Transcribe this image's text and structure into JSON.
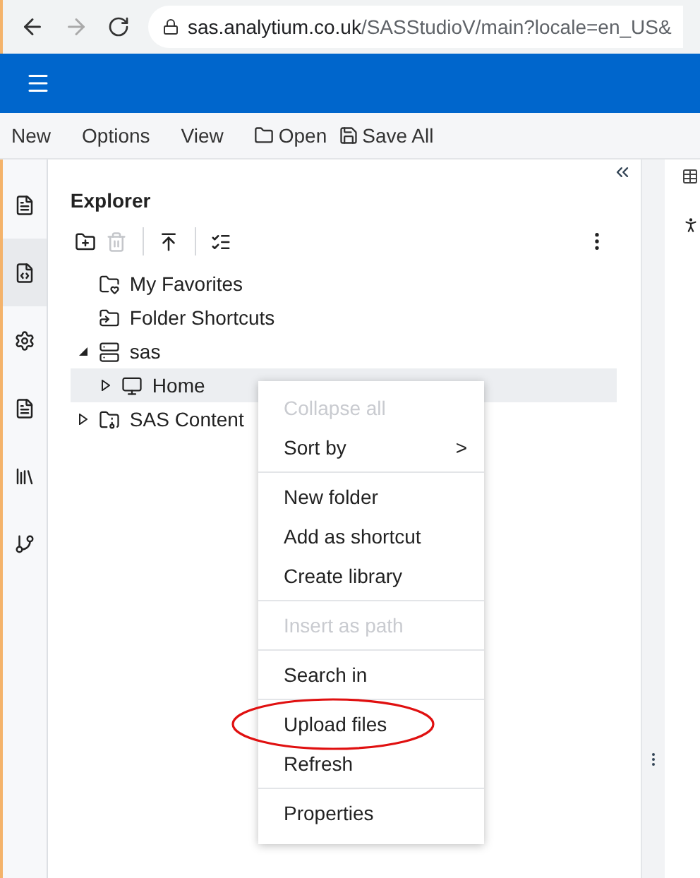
{
  "browser": {
    "url_domain": "sas.analytium.co.uk",
    "url_path": "/SASStudioV/main?locale=en_US&"
  },
  "menu_bar": [
    "New",
    "Options",
    "View",
    "Open",
    "Save All"
  ],
  "rail": [
    {
      "selected": false
    },
    {
      "selected": true
    },
    {
      "selected": false
    },
    {
      "selected": false
    },
    {
      "selected": false
    },
    {
      "selected": false
    }
  ],
  "explorer": {
    "title": "Explorer",
    "toolbar": [
      {
        "disabled": false
      },
      {
        "disabled": true
      },
      {
        "disabled": false
      },
      {
        "disabled": false
      }
    ],
    "tree": [
      {
        "label": "My Favorites",
        "selected": false
      },
      {
        "label": "Folder Shortcuts",
        "selected": false
      },
      {
        "label": "sas",
        "expanded": true,
        "selected": false,
        "children": [
          {
            "label": "Home",
            "expanded": false,
            "selected": true
          }
        ]
      },
      {
        "label": "SAS Content",
        "expanded": false,
        "selected": false
      }
    ]
  },
  "context_menu": [
    [
      {
        "label": "Collapse all",
        "disabled": true
      },
      {
        "label": "Sort by",
        "disabled": false,
        "arrow": ">"
      }
    ],
    [
      {
        "label": "New folder",
        "disabled": false
      },
      {
        "label": "Add as shortcut",
        "disabled": false
      },
      {
        "label": "Create library",
        "disabled": false
      }
    ],
    [
      {
        "label": "Insert as path",
        "disabled": true
      }
    ],
    [
      {
        "label": "Search in",
        "disabled": false
      }
    ],
    [
      {
        "label": "Upload files",
        "disabled": false,
        "circled": true
      },
      {
        "label": "Refresh",
        "disabled": false
      }
    ],
    [
      {
        "label": "Properties",
        "disabled": false
      }
    ]
  ]
}
